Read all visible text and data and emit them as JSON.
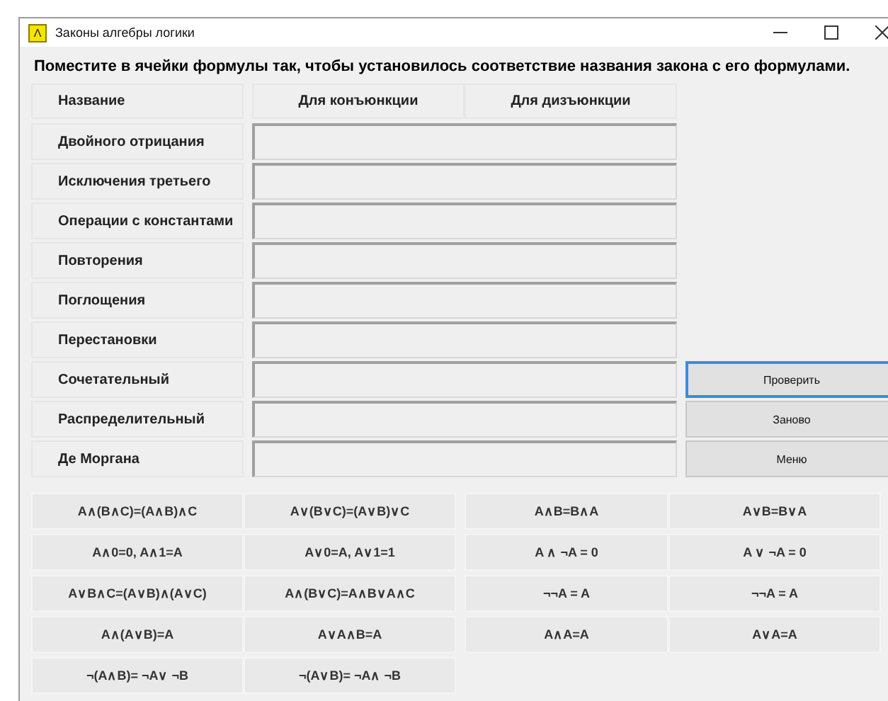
{
  "window": {
    "title": "Законы алгебры логики",
    "icon_text": "Λ"
  },
  "instruction": "Поместите в ячейки формулы так, чтобы установилось соответствие названия закона с его формулами.",
  "columns": [
    "Название",
    "Для конъюнкции",
    "Для дизъюнкции"
  ],
  "laws": [
    {
      "name": "Двойного отрицания"
    },
    {
      "name": "Исключения третьего"
    },
    {
      "name": "Операции с константами"
    },
    {
      "name": "Повторения"
    },
    {
      "name": "Поглощения"
    },
    {
      "name": "Перестановки"
    },
    {
      "name": "Сочетательный"
    },
    {
      "name": "Распределительный"
    },
    {
      "name": "Де Моргана"
    }
  ],
  "buttons": [
    {
      "label": "Проверить",
      "focused": true
    },
    {
      "label": "Заново",
      "focused": false
    },
    {
      "label": "Меню",
      "focused": false
    }
  ],
  "formulas": [
    [
      "A∧(B∧C)=(A∧B)∧C",
      "A∨(B∨C)=(A∨B)∨C",
      "A∧B=B∧A",
      "A∨B=B∨A"
    ],
    [
      "A∧0=0, A∧1=A",
      "A∨0=A, A∨1=1",
      "A ∧ ¬A = 0",
      "A ∨ ¬A = 0"
    ],
    [
      "A∨B∧C=(A∨B)∧(A∨C)",
      "A∧(B∨C)=A∧B∨A∧C",
      "¬¬A = A",
      "¬¬A = A"
    ],
    [
      "A∧(A∨B)=A",
      "A∨A∧B=A",
      "A∧A=A",
      "A∨A=A"
    ],
    [
      "¬(A∧B)= ¬A∨ ¬B",
      "¬(A∨B)= ¬A∧ ¬B"
    ]
  ]
}
